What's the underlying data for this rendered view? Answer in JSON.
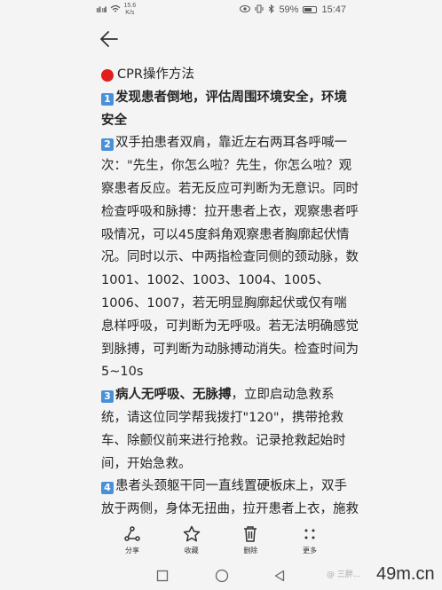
{
  "status_bar": {
    "signal": "ııll ııll",
    "net_speed_value": "15.6",
    "net_speed_unit": "K/s",
    "battery": "59%",
    "time": "15:47"
  },
  "article": {
    "title": "CPR操作方法",
    "step1_num": "1",
    "step1_text": "发现患者倒地，评估周围环境安全，环境安全",
    "step2_num": "2",
    "step2_text": "双手拍患者双肩，靠近左右两耳各呼喊一次：\"先生，你怎么啦？先生，你怎么啦？观察患者反应。若无反应可判断为无意识。同时检查呼吸和脉搏：拉开患者上衣，观察患者呼吸情况，可以45度斜角观察患者胸廓起伏情况。同时以示、中两指检查同侧的颈动脉，数1001、1002、1003、1004、1005、1006、1007，若无明显胸廓起伏或仅有喘息样呼吸，可判断为无呼吸。若无法明确感觉到脉搏，可判断为动脉搏动消失。检查时间为5~10s",
    "step3_num": "3",
    "step3_bold": "病人无呼吸、无脉搏",
    "step3_text": "，立即启动急救系统，请这位同学帮我拨打\"120\"，携带抢救车、除颤仪前来进行抢救。记录抢救起始时间，开始急救。",
    "step4_num": "4",
    "step4_text": "患者头颈躯干同一直线置硬板床上，双手放于两侧，身体无扭曲，拉开患者上衣，施救者位于患者右侧，左脚与患者肩齐，双脚"
  },
  "actions": {
    "share": "分享",
    "favorite": "收藏",
    "delete": "删除",
    "more": "更多"
  },
  "watermark": {
    "source": "@ 三胖...",
    "site": "49m.cn"
  }
}
